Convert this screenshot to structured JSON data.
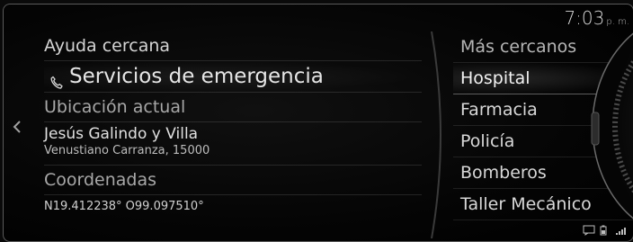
{
  "status_bar": {
    "time": "7:03",
    "time_suffix": "p. m."
  },
  "nav": {
    "back_icon": "chevron-left-icon"
  },
  "left_panel": {
    "nearby_help_header": "Ayuda cercana",
    "emergency_services": "Servicios de emergencia",
    "current_location_header": "Ubicación actual",
    "address_line1": "Jesús Galindo y Villa",
    "address_line2": "Venustiano Carranza, 15000",
    "coordinates_header": "Coordenadas",
    "coordinates_value": "N19.412238° O99.097510°"
  },
  "right_panel": {
    "header": "Más cercanos",
    "items": [
      {
        "label": "Hospital",
        "selected": true
      },
      {
        "label": "Farmacia",
        "selected": false
      },
      {
        "label": "Policía",
        "selected": false
      },
      {
        "label": "Bomberos",
        "selected": false
      },
      {
        "label": "Taller Mecánico",
        "selected": false
      }
    ]
  },
  "status_icons": [
    "message-icon",
    "battery-icon",
    "signal-icon"
  ],
  "colors": {
    "background": "#000000",
    "text_primary": "#e6e6e6",
    "text_secondary": "#a8a8a8"
  }
}
